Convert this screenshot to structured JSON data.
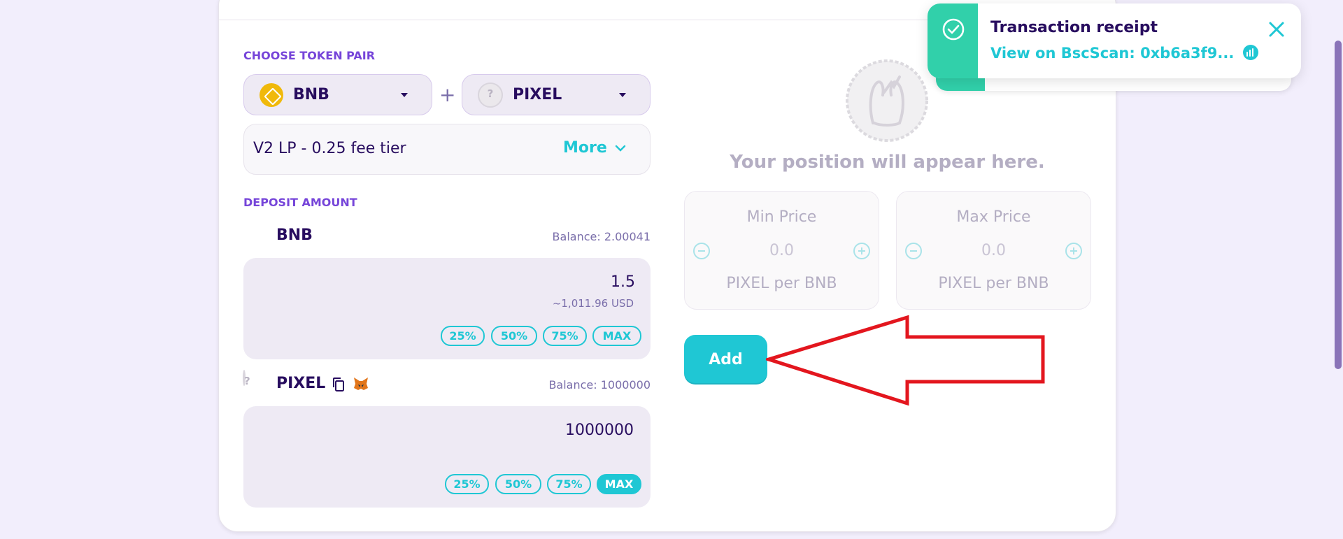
{
  "choose_pair": {
    "label": "CHOOSE TOKEN PAIR",
    "token_a": "BNB",
    "token_b": "PIXEL",
    "plus": "+"
  },
  "fee_tier": {
    "label": "V2 LP - 0.25 fee tier",
    "more": "More"
  },
  "deposit": {
    "label": "DEPOSIT AMOUNT",
    "bnb": {
      "symbol": "BNB",
      "balance": "Balance: 2.00041",
      "amount": "1.5",
      "usd": "~1,011.96 USD"
    },
    "pixel": {
      "symbol": "PIXEL",
      "balance": "Balance: 1000000",
      "amount": "1000000"
    },
    "percent_buttons": [
      "25%",
      "50%",
      "75%",
      "MAX"
    ]
  },
  "position": {
    "placeholder": "Your position will appear here.",
    "min_price": {
      "title": "Min Price",
      "value": "0.0",
      "unit": "PIXEL per BNB"
    },
    "max_price": {
      "title": "Max Price",
      "value": "0.0",
      "unit": "PIXEL per BNB"
    }
  },
  "add_button": "Add",
  "toast": {
    "title": "Transaction receipt",
    "link": "View on BscScan: 0xb6a3f9..."
  },
  "colors": {
    "primary": "#1fc7d4",
    "secondary": "#7645d9",
    "text": "#280d5f",
    "success": "#31d0aa",
    "annotation_arrow": "#e3161e"
  },
  "icons": {
    "toast_status": "check-circle-icon",
    "toast_close": "close-icon",
    "external": "chart-link-icon",
    "copy": "copy-icon",
    "metamask": "metamask-fox-icon"
  }
}
